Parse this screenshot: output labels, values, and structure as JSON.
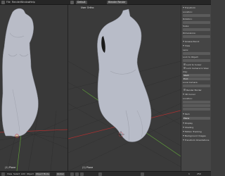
{
  "topbar": {
    "menus": [
      "File",
      "Render",
      "Window",
      "Help"
    ],
    "scene_label": "Default",
    "engine_label": "Blender Render"
  },
  "viewport_right": {
    "label": "User Ortho",
    "object_name": "(1) Plane"
  },
  "viewport_left": {
    "object_name": "(1) Plane"
  },
  "properties": {
    "rows": [
      "Transform",
      "Location:",
      "Rotation:",
      "Scale:",
      "Dimensions:",
      "Grease Pencil",
      "View",
      "Lens:",
      "Lock to Object:",
      "Lock to Cursor",
      "Lock Camera to View",
      "Clip:",
      "Start:",
      "End:",
      "Local Camera:",
      "Render Border",
      "3D Cursor",
      "Location:",
      "Item",
      "Plane",
      "Display",
      "Shading",
      "Motion Tracking",
      "Background Images",
      "Transform Orientations"
    ]
  },
  "bottombar": {
    "view_label": "View",
    "select_label": "Select",
    "add_label": "Add",
    "object_label": "Object",
    "mode_label": "Object Mode",
    "global_label": "Global",
    "frame_start": "1",
    "frame_end": "250"
  },
  "colors": {
    "background": "#393939",
    "grid": "#2e2e2e",
    "axis_red": "#b03030",
    "axis_green": "#5e9a3a",
    "mesh": "#b8bcc8"
  }
}
